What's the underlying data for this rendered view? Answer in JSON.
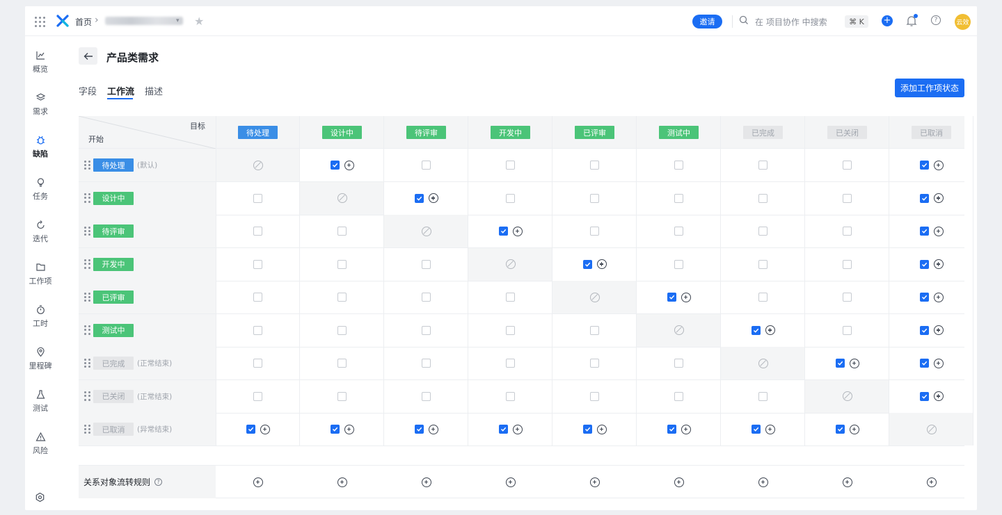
{
  "topbar": {
    "home": "首页",
    "invite": "邀请",
    "search_placeholder": "在 项目协作 中搜索",
    "shortcut": "⌘ K",
    "avatar": "云效",
    "help": "?"
  },
  "sidebar": {
    "items": [
      {
        "label": "概览",
        "icon": "chart-icon"
      },
      {
        "label": "需求",
        "icon": "layers-icon"
      },
      {
        "label": "缺陷",
        "icon": "bug-icon",
        "active": true
      },
      {
        "label": "任务",
        "icon": "bulb-icon"
      },
      {
        "label": "迭代",
        "icon": "cycle-icon"
      },
      {
        "label": "工作项",
        "icon": "folder-icon"
      },
      {
        "label": "工时",
        "icon": "timer-icon"
      },
      {
        "label": "里程碑",
        "icon": "pin-icon"
      },
      {
        "label": "测试",
        "icon": "flask-icon"
      },
      {
        "label": "风险",
        "icon": "warning-icon"
      }
    ]
  },
  "page": {
    "title": "产品类需求",
    "tabs": [
      "字段",
      "工作流",
      "描述"
    ],
    "active_tab": "工作流",
    "add_button": "添加工作项状态"
  },
  "matrix": {
    "target_label": "目标",
    "start_label": "开始",
    "columns": [
      {
        "label": "待处理",
        "color": "blue"
      },
      {
        "label": "设计中",
        "color": "green"
      },
      {
        "label": "待评审",
        "color": "green"
      },
      {
        "label": "开发中",
        "color": "green"
      },
      {
        "label": "已评审",
        "color": "green"
      },
      {
        "label": "测试中",
        "color": "green"
      },
      {
        "label": "已完成",
        "color": "gray"
      },
      {
        "label": "已关闭",
        "color": "gray"
      },
      {
        "label": "已取消",
        "color": "gray"
      }
    ],
    "rows": [
      {
        "label": "待处理",
        "color": "blue",
        "note": "(默认)",
        "cells": [
          "x",
          "on",
          "off",
          "off",
          "off",
          "off",
          "off",
          "off",
          "on"
        ]
      },
      {
        "label": "设计中",
        "color": "green",
        "note": "",
        "cells": [
          "off",
          "x",
          "on",
          "off",
          "off",
          "off",
          "off",
          "off",
          "on"
        ]
      },
      {
        "label": "待评审",
        "color": "green",
        "note": "",
        "cells": [
          "off",
          "off",
          "x",
          "on",
          "off",
          "off",
          "off",
          "off",
          "on"
        ]
      },
      {
        "label": "开发中",
        "color": "green",
        "note": "",
        "cells": [
          "off",
          "off",
          "off",
          "x",
          "on",
          "off",
          "off",
          "off",
          "on"
        ]
      },
      {
        "label": "已评审",
        "color": "green",
        "note": "",
        "cells": [
          "off",
          "off",
          "off",
          "off",
          "x",
          "on",
          "off",
          "off",
          "on"
        ]
      },
      {
        "label": "测试中",
        "color": "green",
        "note": "",
        "cells": [
          "off",
          "off",
          "off",
          "off",
          "off",
          "x",
          "on",
          "off",
          "on"
        ]
      },
      {
        "label": "已完成",
        "color": "gray",
        "note": "(正常结束)",
        "cells": [
          "off",
          "off",
          "off",
          "off",
          "off",
          "off",
          "x",
          "on",
          "on"
        ]
      },
      {
        "label": "已关闭",
        "color": "gray",
        "note": "(正常结束)",
        "cells": [
          "off",
          "off",
          "off",
          "off",
          "off",
          "off",
          "off",
          "x",
          "on"
        ]
      },
      {
        "label": "已取消",
        "color": "gray",
        "note": "(异常结束)",
        "cells": [
          "on",
          "on",
          "on",
          "on",
          "on",
          "on",
          "on",
          "on",
          "x"
        ]
      }
    ],
    "relation_rule_label": "关系对象流转规则",
    "relation_help": "?"
  }
}
